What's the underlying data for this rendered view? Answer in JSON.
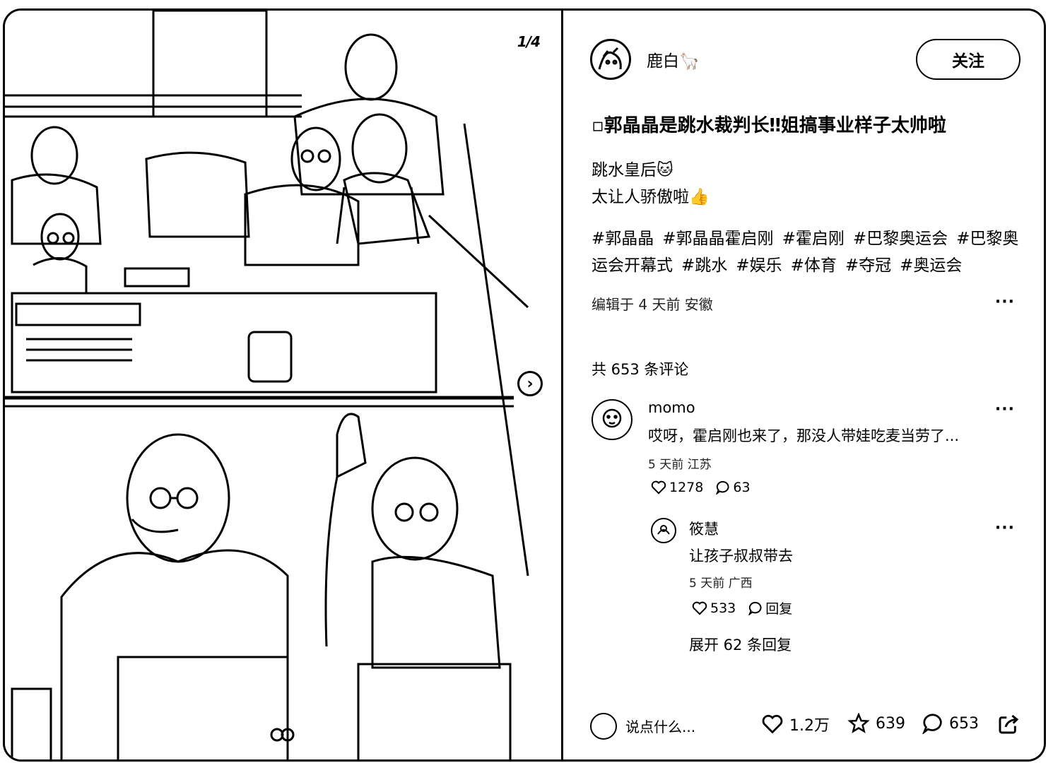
{
  "post": {
    "image_counter": "1/4",
    "author": {
      "name": "鹿白🦙",
      "follow_label": "关注"
    },
    "title": "▫郭晶晶是跳水裁判长‼姐搞事业样子太帅啦",
    "body_lines": [
      "跳水皇后🐱",
      "太让人骄傲啦👍"
    ],
    "tags": [
      "#郭晶晶",
      "#郭晶晶霍启刚",
      "#霍启刚",
      "#巴黎奥运会",
      "#巴黎奥运会开幕式",
      "#跳水",
      "#娱乐",
      "#体育",
      "#夺冠",
      "#奥运会"
    ],
    "meta": "编辑于 4 天前 安徽",
    "more": "···"
  },
  "comments": {
    "count_label": "共 653 条评论",
    "items": [
      {
        "author": "momo",
        "text": "哎呀，霍启刚也来了，那没人带娃吃麦当劳了...",
        "meta": "5 天前 江苏",
        "likes": "1278",
        "replies": "63",
        "more": "···",
        "sub_reply": {
          "author": "筱慧",
          "text": "让孩子叔叔带去",
          "meta": "5 天前 广西",
          "likes": "533",
          "reply_label": "回复",
          "more": "···"
        }
      }
    ],
    "expand_label": "展开 62 条回复"
  },
  "bottom_bar": {
    "input_placeholder": "说点什么...",
    "likes": "1.2万",
    "favorites": "639",
    "comments": "653"
  },
  "icons": {
    "next": "chevron-right-icon",
    "like": "heart-icon",
    "favorite": "star-icon",
    "comment": "comment-bubble-icon",
    "share": "share-icon"
  }
}
